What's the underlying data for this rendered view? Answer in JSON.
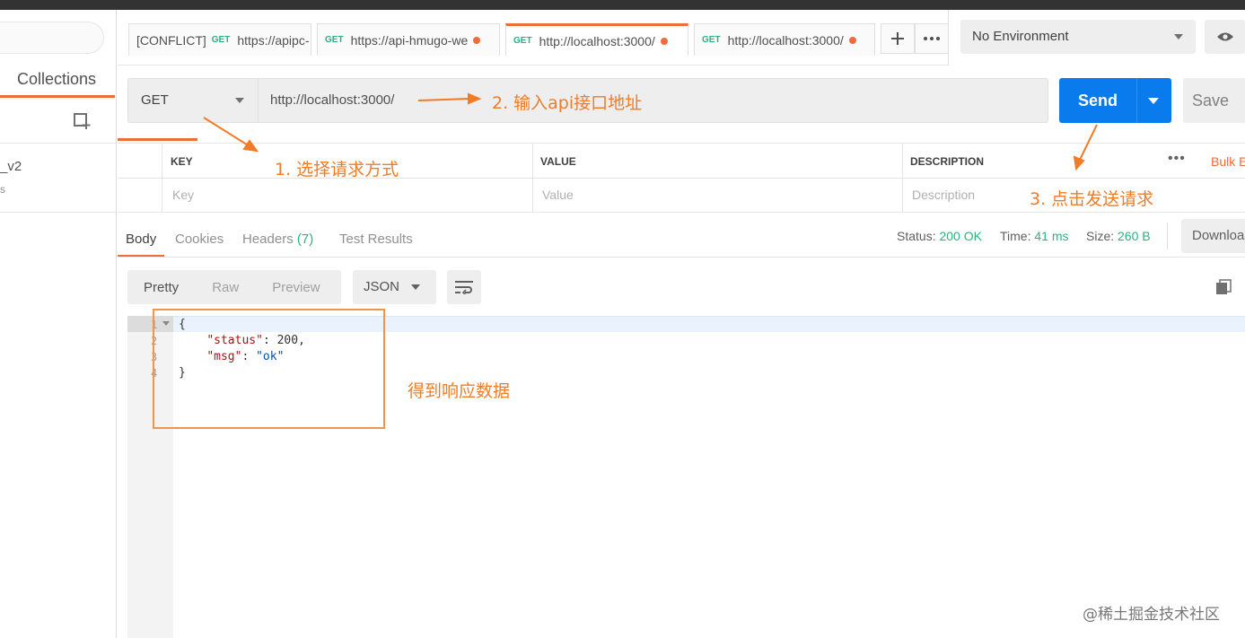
{
  "sidebar": {
    "collections_tab": "Collections",
    "item_name": "_v2",
    "item_sub": "s"
  },
  "tabs": [
    {
      "method": "",
      "prefix": "[CONFLICT]",
      "label": "https://apipc-",
      "dirty": false
    },
    {
      "method": "GET",
      "label": "https://api-hmugo-we",
      "dirty": true
    },
    {
      "method": "GET",
      "label": "http://localhost:3000/",
      "dirty": true,
      "active": true
    },
    {
      "method": "GET",
      "label": "http://localhost:3000/",
      "dirty": true
    }
  ],
  "tab_conflict_method": "GET",
  "environment": {
    "selected": "No Environment"
  },
  "request": {
    "method": "GET",
    "url": "http://localhost:3000/",
    "send_label": "Send",
    "save_label": "Save"
  },
  "params": {
    "headers": {
      "key": "KEY",
      "value": "VALUE",
      "description": "DESCRIPTION"
    },
    "placeholders": {
      "key": "Key",
      "value": "Value",
      "description": "Description"
    },
    "bulk_edit": "Bulk E",
    "more": "•••"
  },
  "response": {
    "tabs": {
      "body": "Body",
      "cookies": "Cookies",
      "headers": "Headers",
      "headers_count": "(7)",
      "tests": "Test Results"
    },
    "status_label": "Status:",
    "status_value": "200 OK",
    "time_label": "Time:",
    "time_value": "41 ms",
    "size_label": "Size:",
    "size_value": "260 B",
    "download": "Download",
    "format": {
      "pretty": "Pretty",
      "raw": "Raw",
      "preview": "Preview",
      "type": "JSON"
    },
    "lines": [
      "1",
      "2",
      "3",
      "4"
    ],
    "code": {
      "l1": "{",
      "l2_key": "\"status\"",
      "l2_val": "200",
      "l3_key": "\"msg\"",
      "l3_val": "\"ok\"",
      "l4": "}"
    }
  },
  "annotations": {
    "a1": "1. 选择请求方式",
    "a2": "2. 输入api接口地址",
    "a3": "3. 点击发送请求",
    "a4": "得到响应数据",
    "color": "#f07c28"
  },
  "watermark": "@稀土掘金技术社区",
  "colors": {
    "accent": "#f26b3a",
    "send": "#097bed",
    "status_ok": "#26b47f"
  }
}
